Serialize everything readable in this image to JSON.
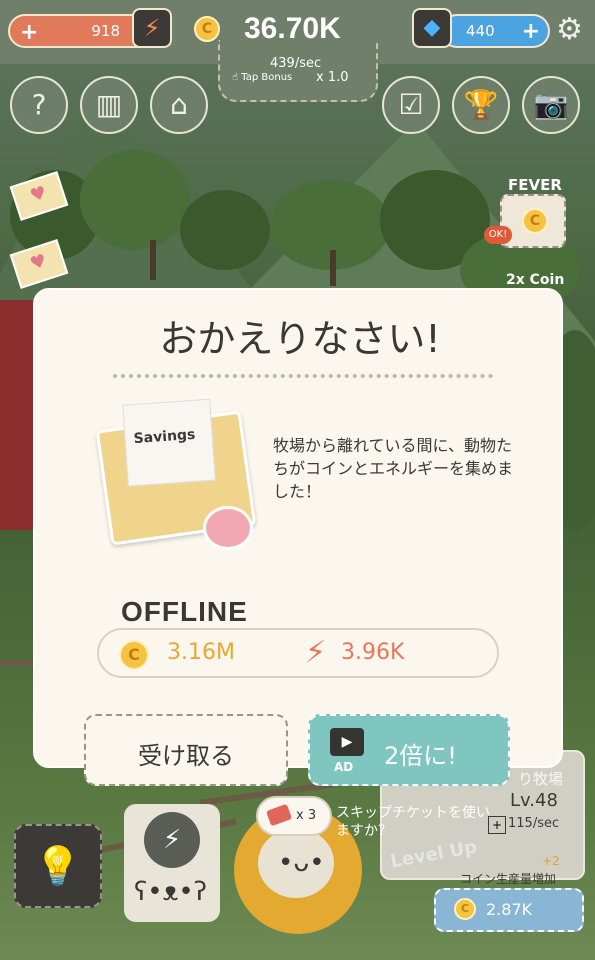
{
  "hud": {
    "energy": "918",
    "energy_plus": "+",
    "energy_icon": "⚡",
    "coin_icon": "C",
    "coin_total": "36.70K",
    "per_sec": "439/sec",
    "tap_bonus_label": "Tap Bonus",
    "tap_multiplier": "x 1.0",
    "gems": "440",
    "gem_plus": "+",
    "gem_icon": "◆",
    "settings_icon": "⚙"
  },
  "menu": {
    "help": "?",
    "ranking": "▥",
    "shop": "⌂",
    "tasks": "☑",
    "trophy": "🏆",
    "camera": "📷"
  },
  "side": {
    "letter_icon": "♥",
    "fever_label": "FEVER",
    "ok_badge": "OK!",
    "fever_coin": "C",
    "coin_2x_label": "2x Coin"
  },
  "modal": {
    "title": "おかえりなさい!",
    "envelope_label": "Savings",
    "message": "牧場から離れている間に、動物たちがコインとエネルギーを集めました！",
    "offline_label": "OFFLINE",
    "coin_icon": "C",
    "coins_earned": "3.16M",
    "energy_icon": "⚡",
    "energy_earned": "3.96K",
    "receive_button": "受け取る",
    "double_button": "2倍に!",
    "ad_badge": "AD",
    "ad_icon": "▶"
  },
  "bottom": {
    "ticket_count": "x 3",
    "skip_question": "スキップチケットを使いますか？",
    "farm_name": "り牧場",
    "farm_level": "Lv.48",
    "farm_rate_plus": "+",
    "farm_rate": "115/sec",
    "level_up_label": "Level Up",
    "level_up_bonus": "+2",
    "level_up_desc": "コイン生産量増加",
    "coin_icon": "C",
    "level_up_cost": "2.87K",
    "hint_icon": "💡",
    "bear_bolt": "⚡",
    "bear_face": "ʕ•ᴥ•ʔ",
    "sheep_face": "•ᴗ•"
  },
  "colors": {
    "energy": "#e07a5a",
    "coin": "#f5c242",
    "gem": "#4ba3e0",
    "double_button": "#7ec6bf",
    "modal_bg": "#fbf7ee"
  }
}
